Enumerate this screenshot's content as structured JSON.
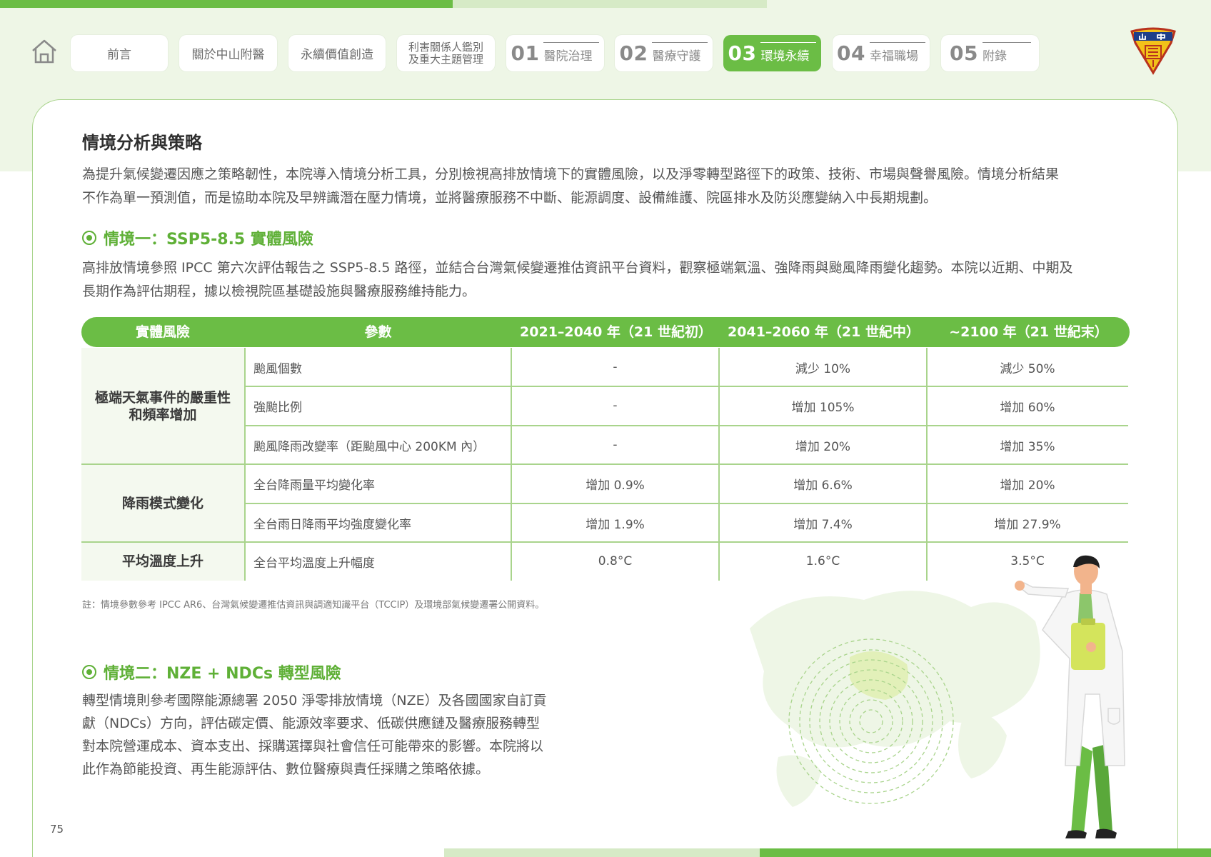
{
  "nav": {
    "items": [
      {
        "label": "前言"
      },
      {
        "label": "關於中山附醫"
      },
      {
        "label": "永續價值創造"
      },
      {
        "line1": "利害關係人鑑別",
        "line2": "及重大主題管理"
      },
      {
        "num": "01",
        "label": "醫院治理"
      },
      {
        "num": "02",
        "label": "醫療守護"
      },
      {
        "num": "03",
        "label": "環境永續",
        "active": true
      },
      {
        "num": "04",
        "label": "幸福職場"
      },
      {
        "num": "05",
        "label": "附錄"
      }
    ]
  },
  "logo": {
    "text": "山中醫"
  },
  "section": {
    "title": "情境分析與策略",
    "intro": [
      "為提升氣候變遷因應之策略韌性，本院導入情境分析工具，分別檢視高排放情境下的實體風險，以及淨零轉型路徑下的政策、技術、市場與聲譽風險。情境分析結果",
      "不作為單一預測值，而是協助本院及早辨識潛在壓力情境，並將醫療服務不中斷、能源調度、設備維護、院區排水及防災應變納入中長期規劃。"
    ]
  },
  "scenario1": {
    "title": "情境一：SSP5-8.5 實體風險",
    "desc": [
      "高排放情境參照 IPCC 第六次評估報告之 SSP5-8.5 路徑，並結合台灣氣候變遷推估資訊平台資料，觀察極端氣溫、強降雨與颱風降雨變化趨勢。本院以近期、中期及",
      "長期作為評估期程，據以檢視院區基礎設施與醫療服務維持能力。"
    ]
  },
  "table": {
    "headers": [
      "實體風險",
      "參數",
      "2021–2040 年（21 世紀初）",
      "2041–2060 年（21 世紀中）",
      "~2100 年（21 世紀末）"
    ],
    "categories": [
      {
        "line1": "極端天氣事件的嚴重性",
        "line2": "和頻率增加"
      },
      {
        "line1": "降雨模式變化",
        "line2": ""
      },
      {
        "line1": "平均溫度上升",
        "line2": ""
      }
    ],
    "rows": [
      {
        "param": "颱風個數",
        "v1": "-",
        "v2": "減少 10%",
        "v3": "減少 50%"
      },
      {
        "param": "強颱比例",
        "v1": "-",
        "v2": "增加 105%",
        "v3": "增加 60%"
      },
      {
        "param": "颱風降雨改變率（距颱風中心 200KM 內）",
        "v1": "-",
        "v2": "增加 20%",
        "v3": "增加 35%"
      },
      {
        "param": "全台降雨量平均變化率",
        "v1": "增加 0.9%",
        "v2": "增加 6.6%",
        "v3": "增加 20%"
      },
      {
        "param": "全台雨日降雨平均強度變化率",
        "v1": "增加 1.9%",
        "v2": "增加 7.4%",
        "v3": "增加 27.9%"
      },
      {
        "param": "全台平均溫度上升幅度",
        "v1": "0.8°C",
        "v2": "1.6°C",
        "v3": "3.5°C"
      }
    ],
    "note": "註：情境參數參考 IPCC AR6、台灣氣候變遷推估資訊與調適知識平台（TCCIP）及環境部氣候變遷署公開資料。"
  },
  "scenario2": {
    "title": "情境二：NZE + NDCs 轉型風險",
    "desc": [
      "轉型情境則參考國際能源總署 2050 淨零排放情境（NZE）及各國國家自訂貢",
      "獻（NDCs）方向，評估碳定價、能源效率要求、低碳供應鏈及醫療服務轉型",
      "對本院營運成本、資本支出、採購選擇與社會信任可能帶來的影響。本院將以",
      "此作為節能投資、再生能源評估、數位醫療與責任採購之策略依據。"
    ]
  },
  "page_number": "75",
  "colors": {
    "accent": "#6bbd45",
    "accent_light": "#d6eac6",
    "band": "#eef6e6"
  }
}
